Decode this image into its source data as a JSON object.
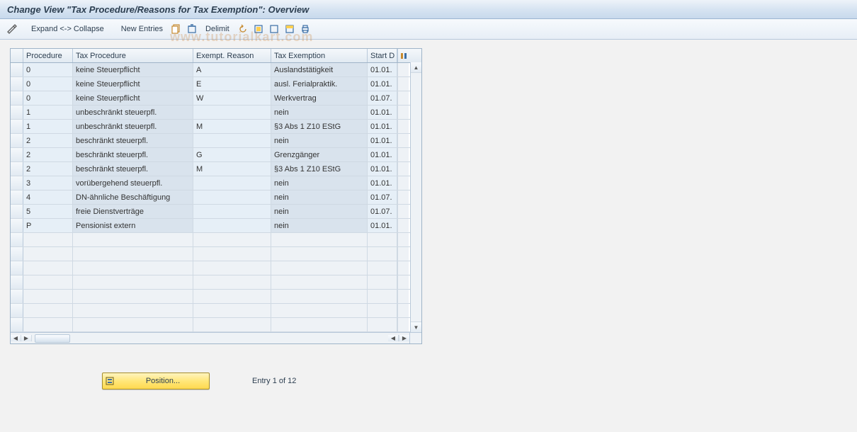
{
  "title": "Change View \"Tax Procedure/Reasons for Tax Exemption\": Overview",
  "toolbar": {
    "expand_collapse": "Expand <-> Collapse",
    "new_entries": "New Entries",
    "delimit": "Delimit"
  },
  "columns": {
    "procedure": "Procedure",
    "tax_procedure": "Tax Procedure",
    "exempt_reason": "Exempt. Reason",
    "tax_exemption": "Tax Exemption",
    "start_date": "Start D"
  },
  "rows": [
    {
      "proc": "0",
      "tax": "keine Steuerpflicht",
      "exr": "A",
      "texe": "Auslandstätigkeit",
      "start": "01.01."
    },
    {
      "proc": "0",
      "tax": "keine Steuerpflicht",
      "exr": "E",
      "texe": "ausl. Ferialpraktik.",
      "start": "01.01."
    },
    {
      "proc": "0",
      "tax": "keine Steuerpflicht",
      "exr": "W",
      "texe": "Werkvertrag",
      "start": "01.07."
    },
    {
      "proc": "1",
      "tax": "unbeschränkt steuerpfl.",
      "exr": "",
      "texe": "nein",
      "start": "01.01."
    },
    {
      "proc": "1",
      "tax": "unbeschränkt steuerpfl.",
      "exr": "M",
      "texe": "§3 Abs 1 Z10 EStG",
      "start": "01.01."
    },
    {
      "proc": "2",
      "tax": "beschränkt steuerpfl.",
      "exr": "",
      "texe": "nein",
      "start": "01.01."
    },
    {
      "proc": "2",
      "tax": "beschränkt steuerpfl.",
      "exr": "G",
      "texe": "Grenzgänger",
      "start": "01.01."
    },
    {
      "proc": "2",
      "tax": "beschränkt steuerpfl.",
      "exr": "M",
      "texe": "§3 Abs 1 Z10 EStG",
      "start": "01.01."
    },
    {
      "proc": "3",
      "tax": "vorübergehend steuerpfl.",
      "exr": "",
      "texe": "nein",
      "start": "01.01."
    },
    {
      "proc": "4",
      "tax": "DN-ähnliche Beschäftigung",
      "exr": "",
      "texe": "nein",
      "start": "01.07."
    },
    {
      "proc": "5",
      "tax": "freie Dienstverträge",
      "exr": "",
      "texe": "nein",
      "start": "01.07."
    },
    {
      "proc": "P",
      "tax": "Pensionist extern",
      "exr": "",
      "texe": "nein",
      "start": "01.01."
    }
  ],
  "empty_rows": 7,
  "footer": {
    "position_label": "Position...",
    "entry_text": "Entry 1 of 12"
  },
  "watermark": "www.tutorialkart.com"
}
